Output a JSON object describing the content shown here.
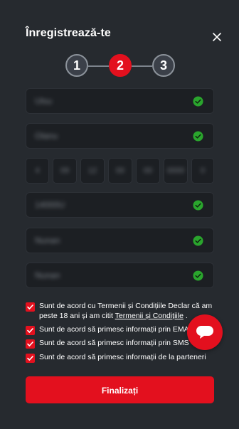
{
  "header": {
    "title": "Înregistrează-te",
    "close_icon": "close-icon"
  },
  "stepper": {
    "steps": [
      "1",
      "2",
      "3"
    ],
    "active_step": 2
  },
  "fields": [
    {
      "value": "Ulsu"
    },
    {
      "value": "Olanu"
    },
    {
      "value": "14000U"
    },
    {
      "value": "Nunan"
    },
    {
      "value": "Nunan"
    }
  ],
  "date_of_birth": {
    "parts": [
      "4",
      "09",
      "12",
      "00",
      "00",
      "0000",
      "0"
    ]
  },
  "consents": {
    "terms": {
      "line1": "Sunt de acord cu Termenii și Condițiile Declar că am",
      "line2_prefix": "peste 18 ani și am citit ",
      "link": "Termenii și Condițiile",
      "line2_suffix": " ."
    },
    "email": "Sunt de acord să primesc informații prin EMAIL",
    "sms": "Sunt de acord să primesc informații prin SMS",
    "partners": "Sunt de acord să primesc informații de la parteneri"
  },
  "actions": {
    "finish_label": "Finalizați"
  },
  "colors": {
    "accent": "#e3101e",
    "background": "#262a2f",
    "field": "#1c1f23",
    "valid": "#2aa52d"
  }
}
